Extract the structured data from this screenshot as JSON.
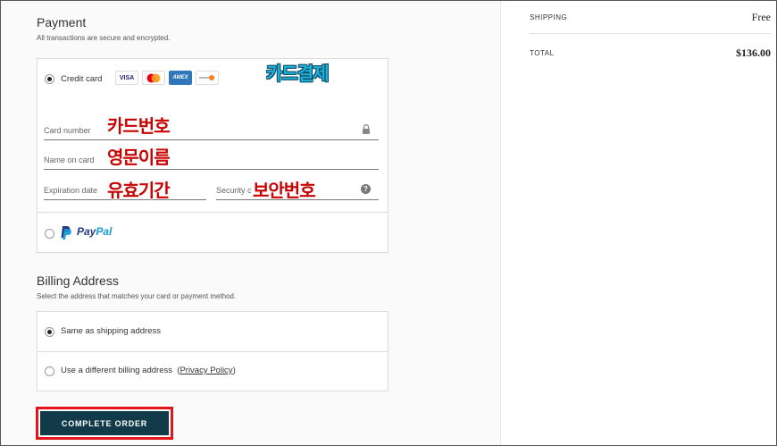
{
  "payment": {
    "title": "Payment",
    "subtitle": "All transactions are secure and encrypted.",
    "credit_card": {
      "label": "Credit card",
      "logos": [
        "VISA",
        "mastercard",
        "AMEX",
        "discover"
      ],
      "fields": {
        "card_number": "Card number",
        "name_on_card": "Name on card",
        "expiration_date": "Expiration date",
        "security_code": "Security c"
      }
    },
    "paypal": {
      "label_pay": "Pay",
      "label_pal": "Pal"
    }
  },
  "annotations": {
    "card_payment": "카드결제",
    "card_number": "카드번호",
    "english_name": "영문이름",
    "expiry": "유효기간",
    "security": "보안번호"
  },
  "billing": {
    "title": "Billing Address",
    "subtitle": "Select the address that matches your card or payment method.",
    "same_as_shipping": "Same as shipping address",
    "different_address": "Use a different billing address",
    "privacy_open": "(",
    "privacy_link": "Privacy Policy",
    "privacy_close": ")"
  },
  "complete_button": "COMPLETE ORDER",
  "summary": {
    "shipping_label": "SHIPPING",
    "shipping_value": "Free",
    "total_label": "TOTAL",
    "total_value": "$136.00"
  },
  "colors": {
    "button_bg": "#123b49",
    "highlight_border": "#e3161b",
    "annotation_red": "#c90000",
    "annotation_cyan": "#20b0d8",
    "paypal_dark": "#253b80",
    "paypal_light": "#179bd7"
  }
}
